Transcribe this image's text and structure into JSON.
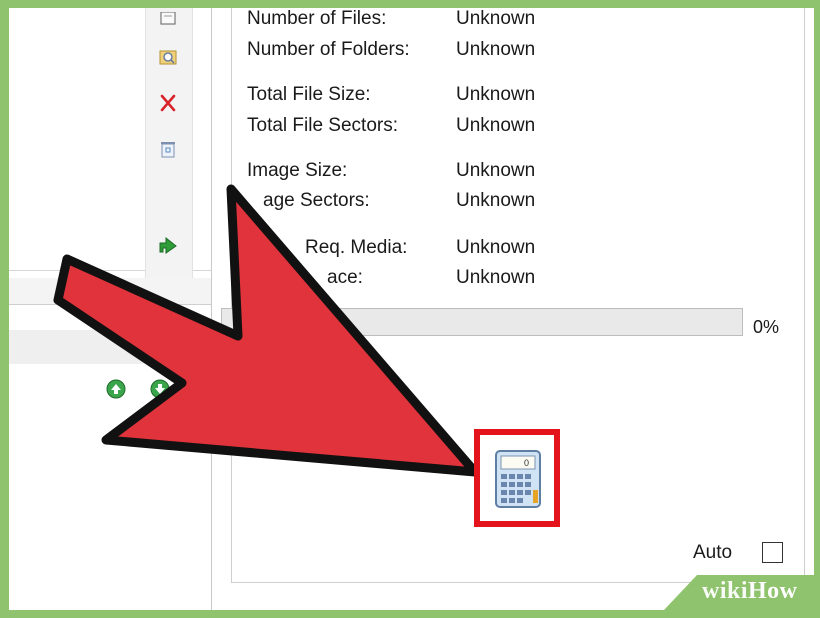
{
  "stats": {
    "rows": [
      {
        "label": "Number of Files:",
        "value": "Unknown"
      },
      {
        "label": "Number of Folders:",
        "value": "Unknown"
      },
      {
        "label": "Total File Size:",
        "value": "Unknown"
      },
      {
        "label": "Total File Sectors:",
        "value": "Unknown"
      },
      {
        "label": "Image Size:",
        "value": "Unknown"
      },
      {
        "label": "age Sectors:",
        "value": "Unknown"
      },
      {
        "label": "Req. Media:",
        "value": "Unknown"
      },
      {
        "label": "ace:",
        "value": "Unknown"
      }
    ]
  },
  "progress": {
    "percent_label": "0%",
    "value": 0
  },
  "calculate": {
    "icon": "calculator-icon"
  },
  "auto": {
    "label": "Auto",
    "checked": false
  },
  "toolbar": {
    "icons": [
      "document-icon",
      "search-folder-icon",
      "delete-x-icon",
      "recycle-bin-icon",
      "green-arrow-icon"
    ]
  },
  "nav": {
    "icons": [
      "move-up-icon",
      "move-down-icon"
    ]
  },
  "watermark": {
    "part1": "wiki",
    "part2": "How"
  },
  "colors": {
    "accent_red": "#e3141b",
    "frame_green": "#8fc36d",
    "arrow_red": "#e0333b"
  }
}
